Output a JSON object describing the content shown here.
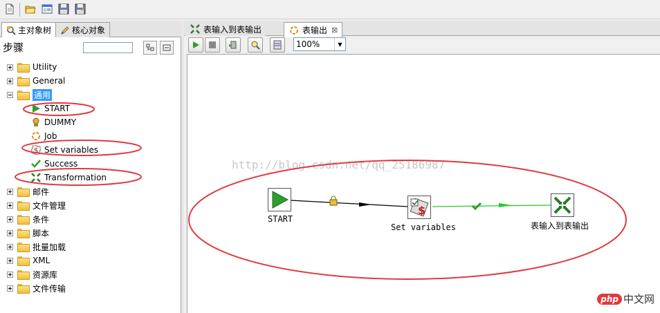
{
  "left_panel": {
    "tabs": [
      {
        "label": "主对象树"
      },
      {
        "label": "核心对象"
      }
    ],
    "section_title": "步骤",
    "search_value": "",
    "tree": [
      {
        "label": "Utility",
        "type": "folder",
        "expanded": false
      },
      {
        "label": "General",
        "type": "folder",
        "expanded": false
      },
      {
        "label": "通用",
        "type": "folder",
        "expanded": true,
        "selected": true
      },
      {
        "label": "START",
        "type": "leaf",
        "icon": "start-icon"
      },
      {
        "label": "DUMMY",
        "type": "leaf",
        "icon": "dummy-icon"
      },
      {
        "label": "Job",
        "type": "leaf",
        "icon": "job-icon"
      },
      {
        "label": "Set variables",
        "type": "leaf",
        "icon": "set-variables-icon"
      },
      {
        "label": "Success",
        "type": "leaf",
        "icon": "success-icon"
      },
      {
        "label": "Transformation",
        "type": "leaf",
        "icon": "transformation-icon"
      },
      {
        "label": "邮件",
        "type": "folder",
        "expanded": false
      },
      {
        "label": "文件管理",
        "type": "folder",
        "expanded": false
      },
      {
        "label": "条件",
        "type": "folder",
        "expanded": false
      },
      {
        "label": "脚本",
        "type": "folder",
        "expanded": false
      },
      {
        "label": "批量加载",
        "type": "folder",
        "expanded": false
      },
      {
        "label": "XML",
        "type": "folder",
        "expanded": false
      },
      {
        "label": "资源库",
        "type": "folder",
        "expanded": false
      },
      {
        "label": "文件传输",
        "type": "folder",
        "expanded": false
      }
    ]
  },
  "editor": {
    "tabs": [
      {
        "label": "表输入到表输出",
        "active": false
      },
      {
        "label": "表输出",
        "active": true,
        "close": "⊠"
      }
    ],
    "zoom": "100%",
    "watermark": "http://blog.csdn.net/qq_25186987",
    "nodes": [
      {
        "label": "START",
        "icon": "start-icon"
      },
      {
        "label": "Set variables",
        "icon": "set-variables-icon"
      },
      {
        "label": "表输入到表输出",
        "icon": "transformation-icon"
      }
    ]
  },
  "php_logo": {
    "php": "php",
    "text": "中文网"
  },
  "colors": {
    "annotation_red": "#e0393e",
    "hop_green": "#22cc22",
    "start_green": "#2e9e2e"
  }
}
